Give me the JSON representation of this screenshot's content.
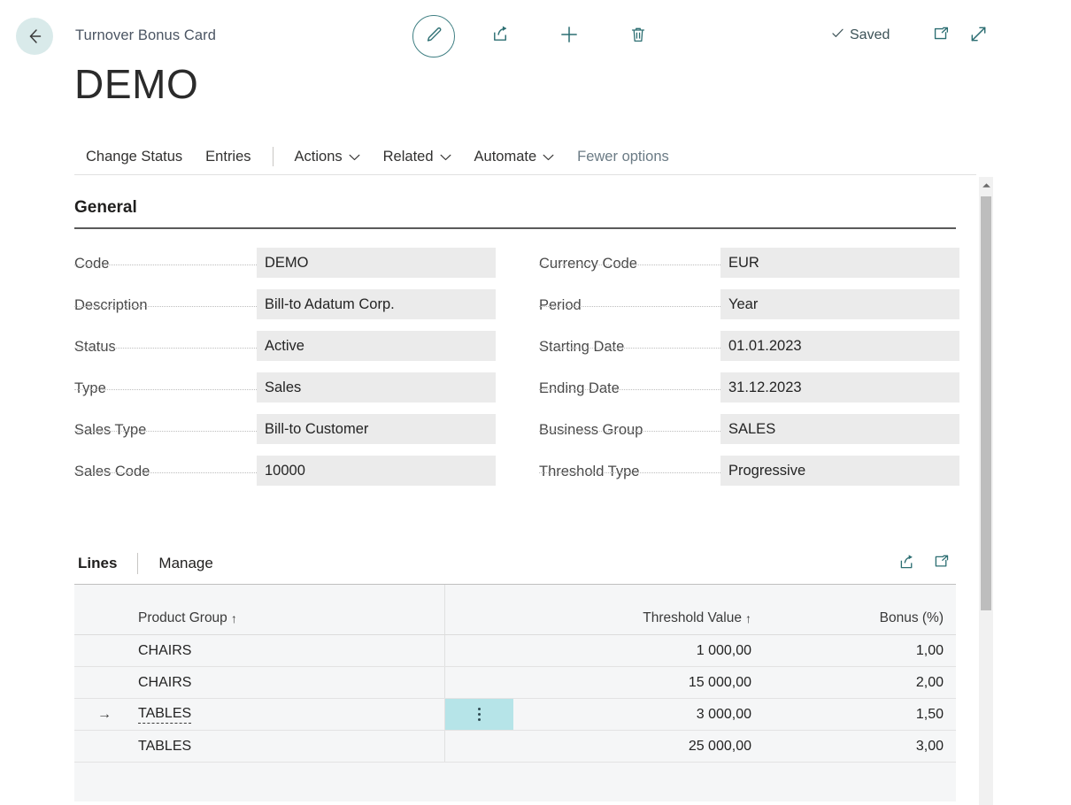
{
  "topbar": {
    "back_icon": "back-arrow-icon",
    "page_kind": "Turnover Bonus Card",
    "edit_icon": "pencil-icon",
    "share_icon": "share-icon",
    "new_icon": "plus-icon",
    "delete_icon": "trash-icon",
    "saved_label": "Saved",
    "saved_check_icon": "check-icon",
    "open_new_window_icon": "open-in-new-window-icon",
    "fullscreen_icon": "expand-diagonal-icon"
  },
  "title": "DEMO",
  "actions": [
    {
      "label": "Change Status",
      "has_caret": false,
      "muted": false
    },
    {
      "label": "Entries",
      "has_caret": false,
      "muted": false
    },
    {
      "label": "Actions",
      "has_caret": true,
      "muted": false
    },
    {
      "label": "Related",
      "has_caret": true,
      "muted": false
    },
    {
      "label": "Automate",
      "has_caret": true,
      "muted": false
    },
    {
      "label": "Fewer options",
      "has_caret": false,
      "muted": true
    }
  ],
  "general": {
    "heading": "General",
    "left_fields": [
      {
        "label": "Code",
        "value": "DEMO"
      },
      {
        "label": "Description",
        "value": "Bill-to Adatum Corp."
      },
      {
        "label": "Status",
        "value": "Active"
      },
      {
        "label": "Type",
        "value": "Sales"
      },
      {
        "label": "Sales Type",
        "value": "Bill-to Customer"
      },
      {
        "label": "Sales Code",
        "value": "10000"
      }
    ],
    "right_fields": [
      {
        "label": "Currency Code",
        "value": "EUR"
      },
      {
        "label": "Period",
        "value": "Year"
      },
      {
        "label": "Starting Date",
        "value": "01.01.2023"
      },
      {
        "label": "Ending Date",
        "value": "31.12.2023"
      },
      {
        "label": "Business Group",
        "value": "SALES"
      },
      {
        "label": "Threshold Type",
        "value": "Progressive"
      }
    ]
  },
  "lines": {
    "tabs": [
      {
        "label": "Lines",
        "active": true
      },
      {
        "label": "Manage",
        "active": false
      }
    ],
    "share_icon": "share-icon",
    "expand_icon": "open-in-new-window-icon",
    "columns": [
      {
        "label": "Product Group",
        "sorted": true,
        "sort_arrow": "↑"
      },
      {
        "label": "Threshold Value",
        "sorted": true,
        "sort_arrow": "↑"
      },
      {
        "label": "Bonus (%)",
        "sorted": false,
        "sort_arrow": ""
      }
    ],
    "rows": [
      {
        "selected": false,
        "indicator": "",
        "product_group": "CHAIRS",
        "threshold_value": "1 000,00",
        "bonus": "1,00"
      },
      {
        "selected": false,
        "indicator": "",
        "product_group": "CHAIRS",
        "threshold_value": "15 000,00",
        "bonus": "2,00"
      },
      {
        "selected": true,
        "indicator": "→",
        "product_group": "TABLES",
        "threshold_value": "3 000,00",
        "bonus": "1,50"
      },
      {
        "selected": false,
        "indicator": "",
        "product_group": "TABLES",
        "threshold_value": "25 000,00",
        "bonus": "3,00"
      }
    ]
  },
  "colors": {
    "accent_teal": "#2c6e72",
    "back_circle": "#d9eaea",
    "selected_cell": "#b6e4e8",
    "field_bg": "#ebebeb",
    "grid_bg": "#f5f6f7"
  },
  "scrollbar": {
    "up_arrow_icon": "chevron-up-icon"
  }
}
